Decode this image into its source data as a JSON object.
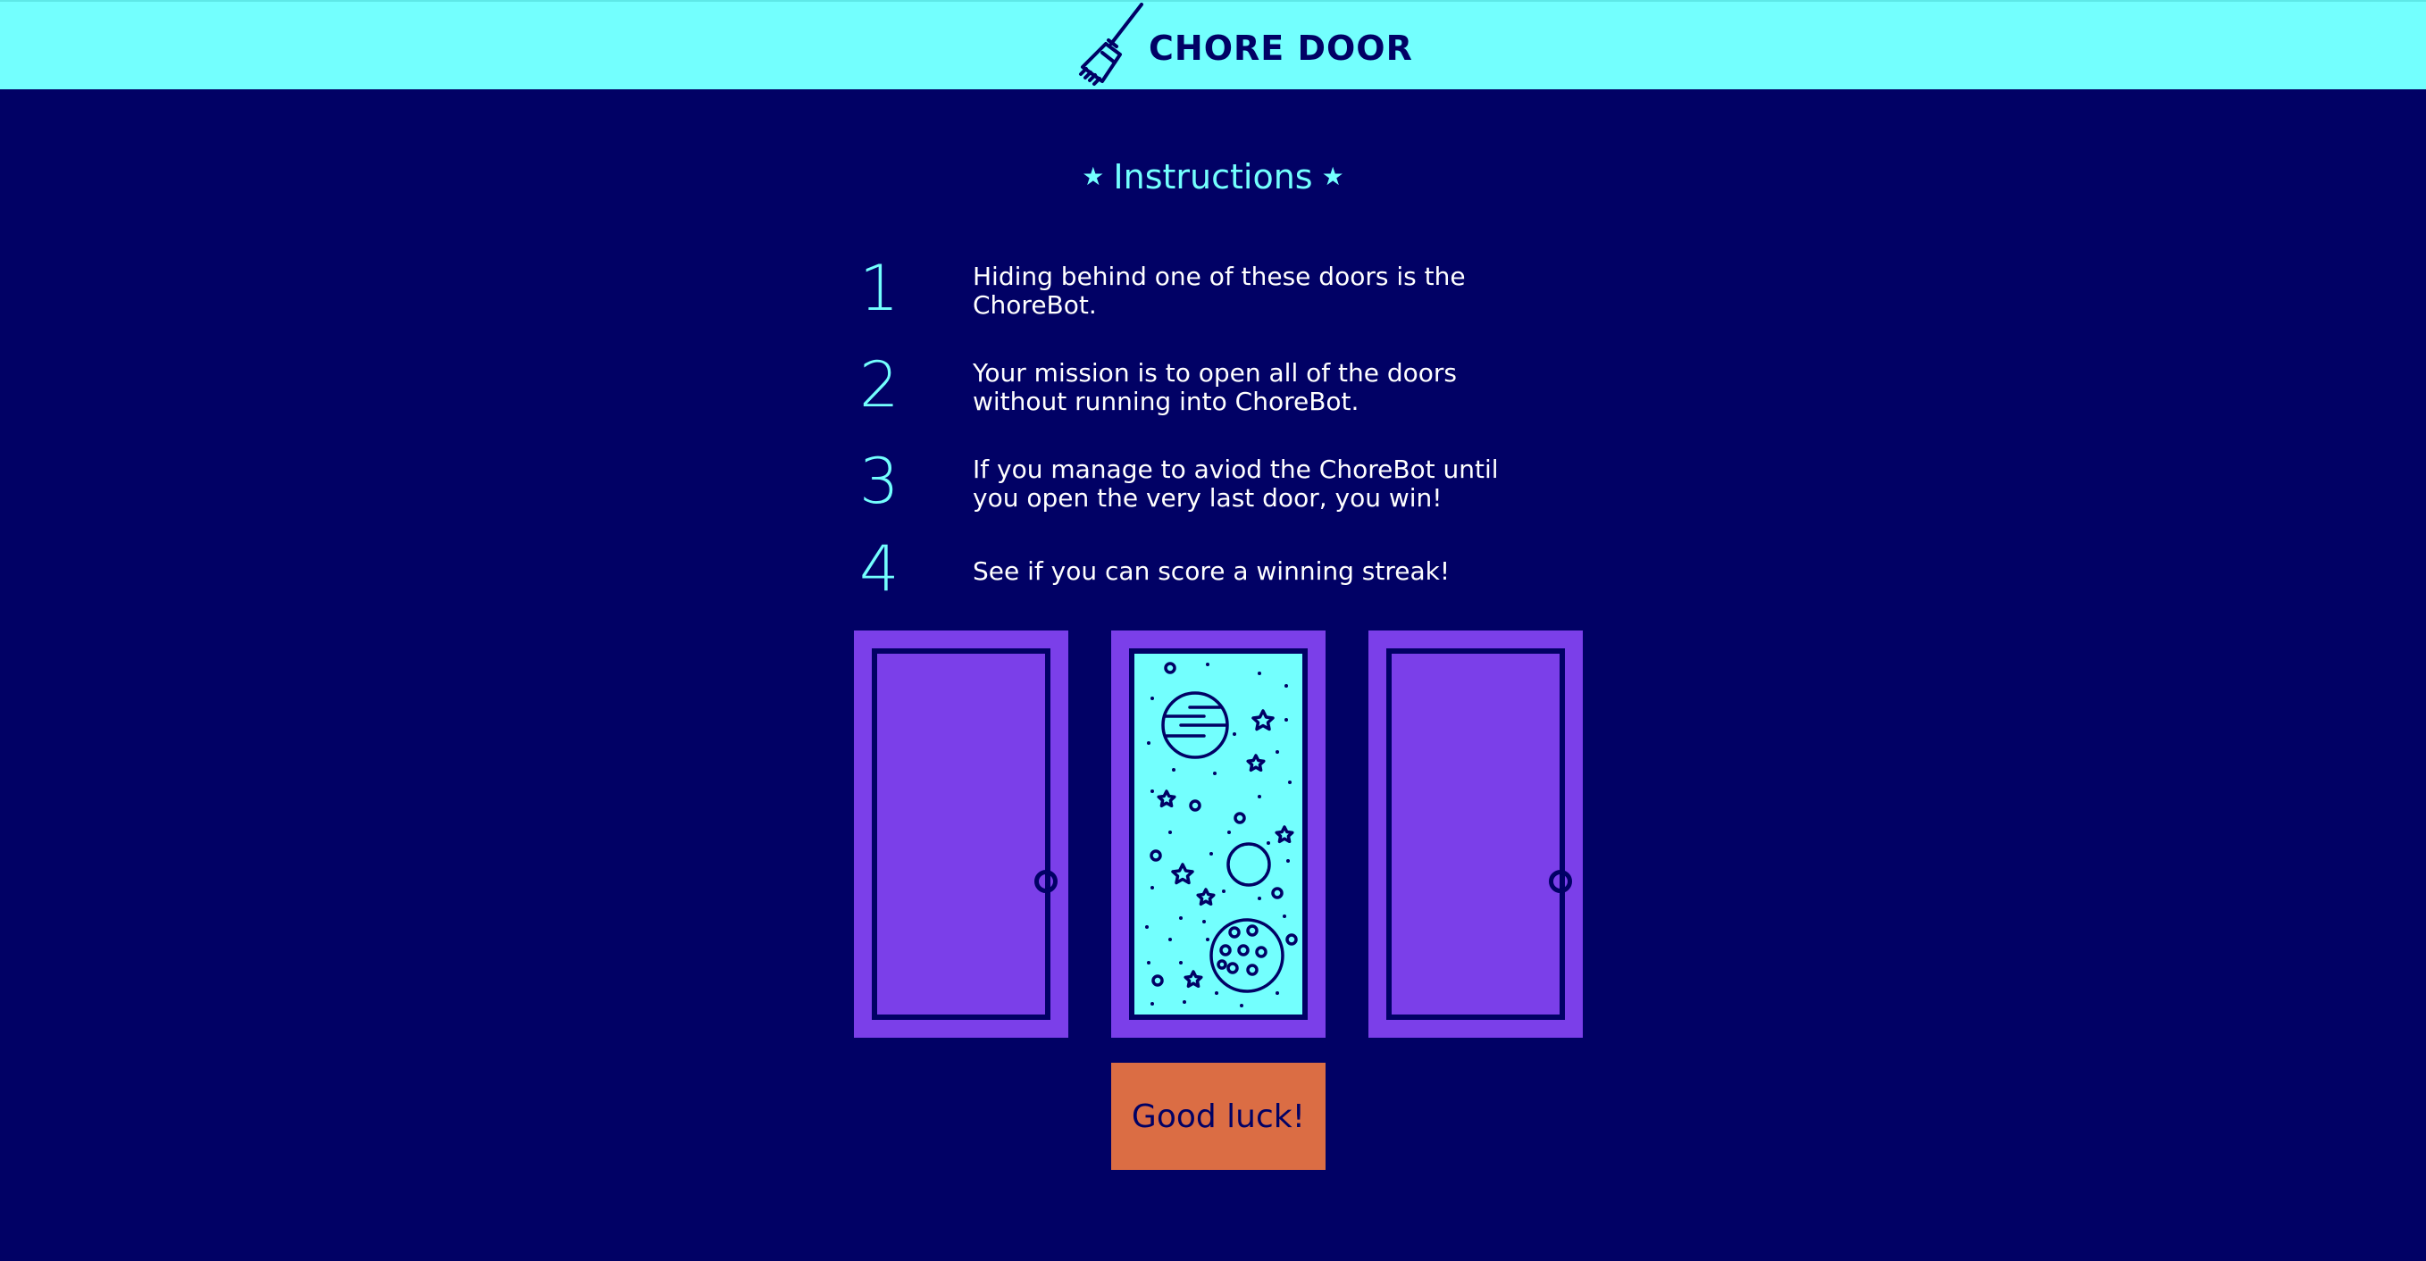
{
  "header": {
    "title": "CHORE DOOR",
    "logo_icon": "broom-icon"
  },
  "instructions": {
    "title": "Instructions",
    "star_glyph": "★",
    "steps": [
      {
        "number": "1",
        "text": "Hiding behind one of these doors is the ChoreBot."
      },
      {
        "number": "2",
        "text": "Your mission is to open all of the doors without running into ChoreBot."
      },
      {
        "number": "3",
        "text": "If you manage to aviod the ChoreBot until you open the very last door, you win!"
      },
      {
        "number": "4",
        "text": "See if you can score a winning streak!"
      }
    ]
  },
  "doors": [
    {
      "state": "closed"
    },
    {
      "state": "open-space"
    },
    {
      "state": "closed"
    }
  ],
  "start_button": {
    "label": "Good luck!"
  },
  "colors": {
    "background": "#010165",
    "accent_cyan": "#73fffe",
    "door_purple": "#7b3fe9",
    "button_orange": "#db6d44"
  }
}
